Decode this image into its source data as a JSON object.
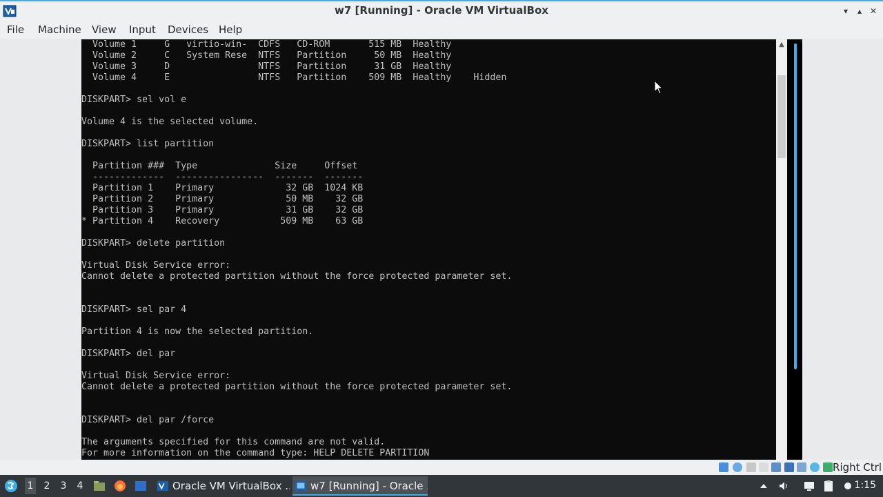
{
  "window": {
    "title": "w7 [Running] - Oracle VM VirtualBox",
    "minimize_glyph": "▾",
    "maximize_glyph": "▴",
    "close_glyph": "✕"
  },
  "menu": {
    "file": "File",
    "machine": "Machine",
    "view": "View",
    "input": "Input",
    "devices": "Devices",
    "help": "Help"
  },
  "console": {
    "lines": [
      "  Volume 1     G   virtio-win-  CDFS   CD-ROM       515 MB  Healthy",
      "  Volume 2     C   System Rese  NTFS   Partition     50 MB  Healthy",
      "  Volume 3     D                NTFS   Partition     31 GB  Healthy",
      "  Volume 4     E                NTFS   Partition    509 MB  Healthy    Hidden",
      "",
      "DISKPART> sel vol e",
      "",
      "Volume 4 is the selected volume.",
      "",
      "DISKPART> list partition",
      "",
      "  Partition ###  Type              Size     Offset",
      "  -------------  ----------------  -------  -------",
      "  Partition 1    Primary             32 GB  1024 KB",
      "  Partition 2    Primary             50 MB    32 GB",
      "  Partition 3    Primary             31 GB    32 GB",
      "* Partition 4    Recovery           509 MB    63 GB",
      "",
      "DISKPART> delete partition",
      "",
      "Virtual Disk Service error:",
      "Cannot delete a protected partition without the force protected parameter set.",
      "",
      "",
      "DISKPART> sel par 4",
      "",
      "Partition 4 is now the selected partition.",
      "",
      "DISKPART> del par",
      "",
      "Virtual Disk Service error:",
      "Cannot delete a protected partition without the force protected parameter set.",
      "",
      "",
      "DISKPART> del par /force",
      "",
      "The arguments specified for this command are not valid.",
      "For more information on the command type: HELP DELETE PARTITION"
    ]
  },
  "scrollbar": {
    "up_glyph": "▲"
  },
  "statusbar": {
    "host_key": "Right Ctrl",
    "icons": [
      "hard-disk-icon",
      "optical-drive-icon",
      "audio-icon",
      "network-icon",
      "usb-icon",
      "shared-folders-icon",
      "display-icon",
      "video-capture-icon",
      "virtualization-icon",
      "mouse-integration-icon",
      "keyboard-icon"
    ]
  },
  "taskbar": {
    "desktops": [
      "1",
      "2",
      "3",
      "4"
    ],
    "active_desktop": "1",
    "tasks": [
      {
        "label": "Oracle VM VirtualBox ..."
      },
      {
        "label": "w7 [Running] - Oracle ..."
      }
    ],
    "clock": "1:15"
  },
  "colors": {
    "accent": "#3daee9",
    "console_bg": "#0c0c0c",
    "console_text": "#c0c0c0",
    "taskbar_bg": "#31363b"
  }
}
